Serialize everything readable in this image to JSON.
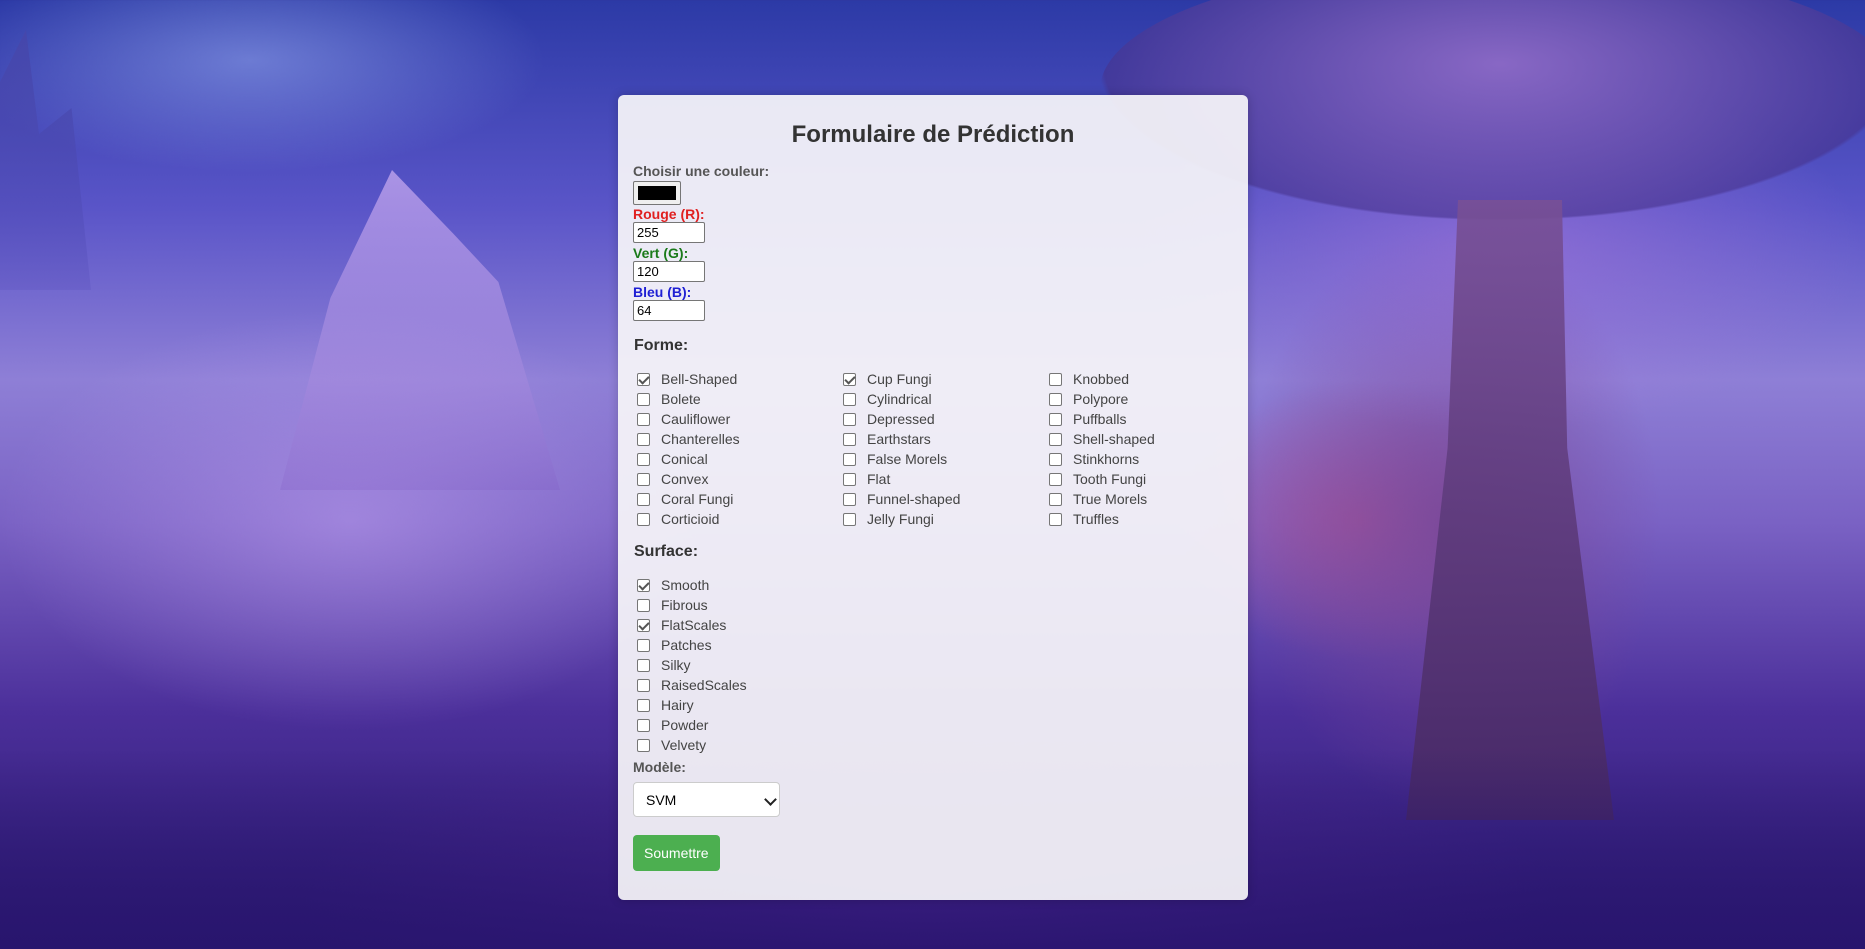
{
  "form": {
    "title": "Formulaire de Prédiction",
    "color_label": "Choisir une couleur:",
    "color_value": "#000000",
    "red_label": "Rouge (R):",
    "red_value": "255",
    "green_label": "Vert (G):",
    "green_value": "120",
    "blue_label": "Bleu (B):",
    "blue_value": "64"
  },
  "forme": {
    "heading": "Forme:",
    "columns": [
      [
        {
          "label": "Bell-Shaped",
          "checked": true
        },
        {
          "label": "Bolete",
          "checked": false
        },
        {
          "label": "Cauliflower",
          "checked": false
        },
        {
          "label": "Chanterelles",
          "checked": false
        },
        {
          "label": "Conical",
          "checked": false
        },
        {
          "label": "Convex",
          "checked": false
        },
        {
          "label": "Coral Fungi",
          "checked": false
        },
        {
          "label": "Corticioid",
          "checked": false
        }
      ],
      [
        {
          "label": "Cup Fungi",
          "checked": true
        },
        {
          "label": "Cylindrical",
          "checked": false
        },
        {
          "label": "Depressed",
          "checked": false
        },
        {
          "label": "Earthstars",
          "checked": false
        },
        {
          "label": "False Morels",
          "checked": false
        },
        {
          "label": "Flat",
          "checked": false
        },
        {
          "label": "Funnel-shaped",
          "checked": false
        },
        {
          "label": "Jelly Fungi",
          "checked": false
        }
      ],
      [
        {
          "label": "Knobbed",
          "checked": false
        },
        {
          "label": "Polypore",
          "checked": false
        },
        {
          "label": "Puffballs",
          "checked": false
        },
        {
          "label": "Shell-shaped",
          "checked": false
        },
        {
          "label": "Stinkhorns",
          "checked": false
        },
        {
          "label": "Tooth Fungi",
          "checked": false
        },
        {
          "label": "True Morels",
          "checked": false
        },
        {
          "label": "Truffles",
          "checked": false
        }
      ]
    ]
  },
  "surface": {
    "heading": "Surface:",
    "items": [
      {
        "label": "Smooth",
        "checked": true
      },
      {
        "label": "Fibrous",
        "checked": false
      },
      {
        "label": "FlatScales",
        "checked": true
      },
      {
        "label": "Patches",
        "checked": false
      },
      {
        "label": "Silky",
        "checked": false
      },
      {
        "label": "RaisedScales",
        "checked": false
      },
      {
        "label": "Hairy",
        "checked": false
      },
      {
        "label": "Powder",
        "checked": false
      },
      {
        "label": "Velvety",
        "checked": false
      }
    ]
  },
  "model": {
    "label": "Modèle:",
    "selected": "SVM"
  },
  "submit_label": "Soumettre"
}
